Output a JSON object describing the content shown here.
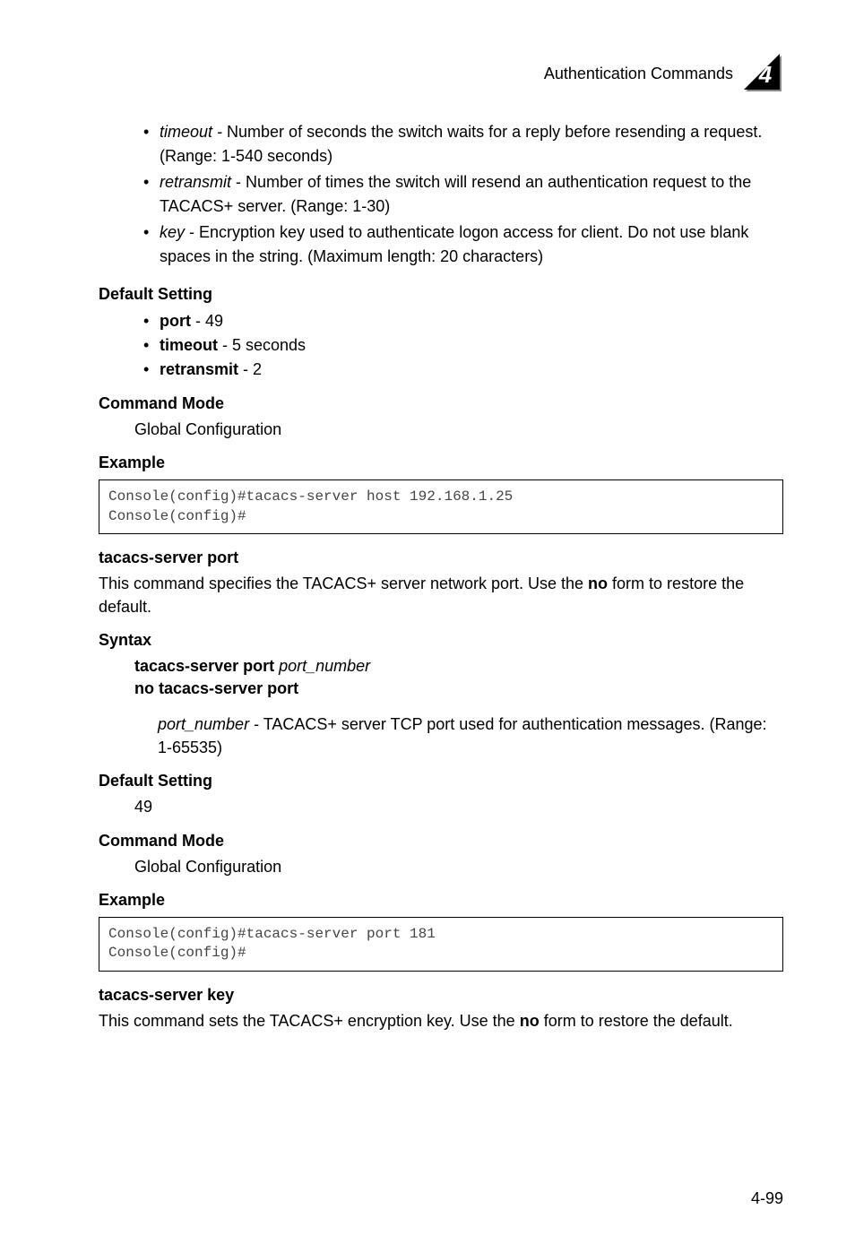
{
  "header": {
    "title": "Authentication Commands",
    "chapter": "4"
  },
  "top_bullets": [
    {
      "term": "timeout - ",
      "desc": "Number of seconds the switch waits for a reply before resending a request. (Range: 1-540 seconds)"
    },
    {
      "term": "retransmit",
      "desc": " - Number of times the switch will resend an authentication request to the TACACS+ server. (Range: 1-30)"
    },
    {
      "term": "key",
      "desc": " - Encryption key used to authenticate logon access for client. Do not use blank spaces in the string. (Maximum length: 20 characters)"
    }
  ],
  "default_setting_label": "Default Setting",
  "default_setting_items": [
    {
      "bold": "port",
      "rest": " - 49"
    },
    {
      "bold": "timeout",
      "rest": " - 5 seconds"
    },
    {
      "bold": "retransmit",
      "rest": " - 2"
    }
  ],
  "command_mode_label": "Command Mode",
  "command_mode_text": "Global Configuration",
  "example_label": "Example",
  "code1_line1": "Console(config)#tacacs-server host 192.168.1.25",
  "code1_line2": "Console(config)#",
  "section2": {
    "title": "tacacs-server port",
    "desc_pre": "This command specifies the TACACS+ server network port. Use the ",
    "desc_bold": "no",
    "desc_post": " form to restore the default.",
    "syntax_label": "Syntax",
    "syntax_line1_bold": "tacacs-server port ",
    "syntax_line1_italic": "port_number",
    "syntax_line2_bold": "no tacacs-server port",
    "param_italic": "port_number",
    "param_desc": " - TACACS+ server TCP port used for authentication messages. (Range: 1-65535)",
    "default_setting_label": "Default Setting",
    "default_value": "49",
    "command_mode_label": "Command Mode",
    "command_mode_text": "Global Configuration",
    "example_label": "Example",
    "code_line1": "Console(config)#tacacs-server port 181",
    "code_line2": "Console(config)#"
  },
  "section3": {
    "title": "tacacs-server key",
    "desc_pre": "This command sets the TACACS+ encryption key. Use the ",
    "desc_bold": "no",
    "desc_post": " form to restore the default."
  },
  "page_number": "4-99"
}
